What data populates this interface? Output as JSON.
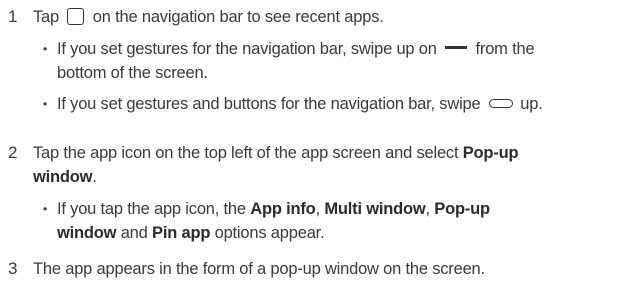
{
  "steps": [
    {
      "number": "1",
      "lines": [
        {
          "pre": "Tap",
          "icon": "recent-apps-square-icon",
          "post": "on the navigation bar to see recent apps."
        }
      ],
      "bullets": [
        {
          "lines": [
            {
              "pre": "If you set gestures for the navigation bar, swipe up on",
              "icon": "home-bar-icon",
              "post": "from the"
            },
            {
              "text": "bottom of the screen."
            }
          ]
        },
        {
          "lines": [
            {
              "pre": "If you set gestures and buttons for the navigation bar, swipe",
              "icon": "home-pill-icon",
              "post": "up."
            }
          ]
        }
      ]
    },
    {
      "number": "2",
      "lines": [
        {
          "pre": "Tap the app icon on the top left of the app screen and select",
          "bold": "Pop-up"
        },
        {
          "bold": "window",
          "post": "."
        }
      ],
      "bullets": [
        {
          "lines": [
            {
              "pre": "If you tap the app icon, the",
              "b1": "App info",
              "s1": ",",
              "b2": "Multi window",
              "s2": ",",
              "b3": "Pop-up"
            },
            {
              "b4": "window",
              "s3": "and",
              "b5": "Pin app",
              "s4": "options appear."
            }
          ]
        }
      ]
    },
    {
      "number": "3",
      "lines": [
        {
          "text": "The app appears in the form of a pop-up window on the screen."
        }
      ],
      "bullets": []
    }
  ],
  "bullet_glyph": "•"
}
